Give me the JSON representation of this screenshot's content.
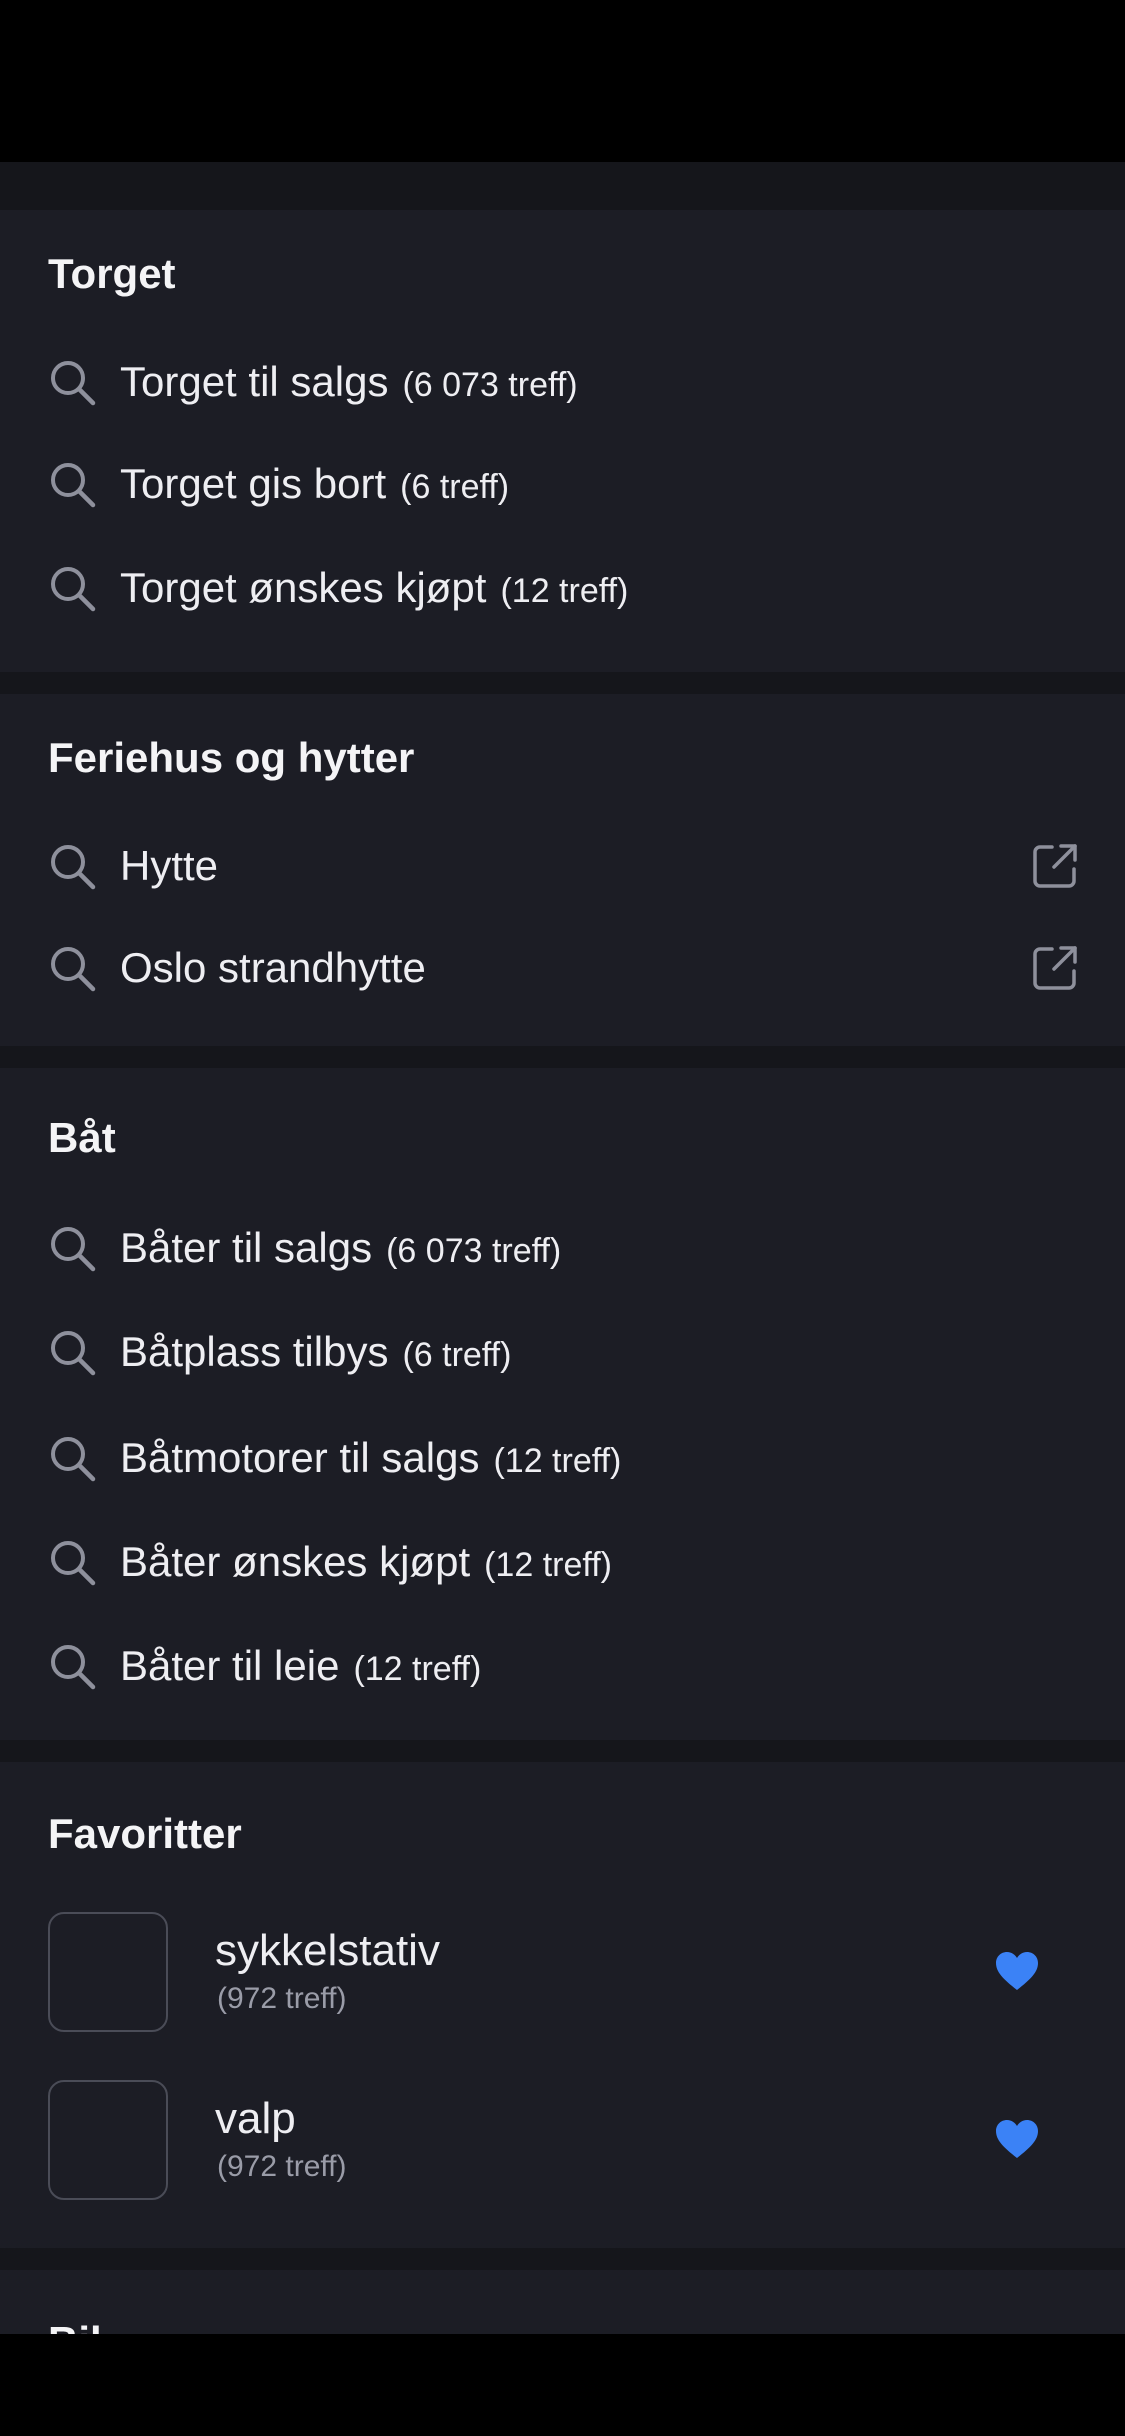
{
  "sections": {
    "torget": {
      "title": "Torget",
      "items": [
        {
          "label": "Torget til salgs",
          "count": "(6 073 treff)"
        },
        {
          "label": "Torget gis bort",
          "count": "(6 treff)"
        },
        {
          "label": "Torget ønskes kjøpt",
          "count": "(12 treff)"
        }
      ]
    },
    "feriehus": {
      "title": "Feriehus og hytter",
      "items": [
        {
          "label": "Hytte"
        },
        {
          "label": "Oslo strandhytte"
        }
      ]
    },
    "bat": {
      "title": "Båt",
      "items": [
        {
          "label": "Båter til salgs",
          "count": "(6 073 treff)"
        },
        {
          "label": "Båtplass tilbys",
          "count": "(6 treff)"
        },
        {
          "label": "Båtmotorer til salgs",
          "count": "(12 treff)"
        },
        {
          "label": "Båter ønskes kjøpt",
          "count": "(12 treff)"
        },
        {
          "label": "Båter til leie",
          "count": "(12 treff)"
        }
      ]
    },
    "favoritter": {
      "title": "Favoritter",
      "items": [
        {
          "title": "sykkelstativ",
          "count": "(972 treff)"
        },
        {
          "title": "valp",
          "count": "(972 treff)"
        }
      ]
    },
    "bil": {
      "title": "Bil"
    }
  },
  "colors": {
    "background": "#15161b",
    "card": "#1c1d25",
    "heart": "#3b82f6",
    "icon": "#8e909c"
  },
  "icons": {
    "search": "search-icon",
    "external": "external-link-icon",
    "favorite": "heart-icon"
  }
}
